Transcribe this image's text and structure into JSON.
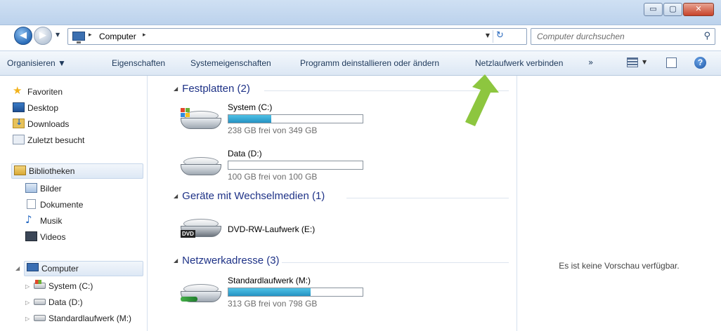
{
  "window": {
    "minimize_glyph": "▭",
    "maximize_glyph": "▢",
    "close_glyph": "✕"
  },
  "address": {
    "path_separator": "▸",
    "location": "Computer",
    "dropdown_glyph": "▼",
    "refresh_glyph": "↻"
  },
  "search": {
    "placeholder": "Computer durchsuchen",
    "icon_glyph": "⚲"
  },
  "toolbar": {
    "organize": "Organisieren ▼",
    "properties": "Eigenschaften",
    "system_properties": "Systemeigenschaften",
    "uninstall": "Programm deinstallieren oder ändern",
    "map_network_drive": "Netzlaufwerk verbinden",
    "more": "»",
    "views_drop": "▼",
    "help": "?"
  },
  "nav": {
    "favorites": "Favoriten",
    "desktop": "Desktop",
    "downloads": "Downloads",
    "recent": "Zuletzt besucht",
    "libraries": "Bibliotheken",
    "pictures": "Bilder",
    "documents": "Dokumente",
    "music": "Musik",
    "videos": "Videos",
    "computer": "Computer",
    "drive_c": "System (C:)",
    "drive_d": "Data (D:)",
    "drive_m": "Standardlaufwerk (M:)",
    "expanded_glyph": "◢",
    "collapsed_glyph": "▷"
  },
  "groups": {
    "hard_disks": "Festplatten (2)",
    "removable": "Geräte mit Wechselmedien (1)",
    "network": "Netzwerkadresse (3)",
    "triangle": "◢"
  },
  "drives": {
    "c": {
      "name": "System (C:)",
      "free": "238 GB frei von 349 GB",
      "used_fraction": 0.32
    },
    "d": {
      "name": "Data (D:)",
      "free": "100 GB frei von 100 GB",
      "used_fraction": 0.0
    },
    "e": {
      "name": "DVD-RW-Laufwerk (E:)",
      "badge": "DVD"
    },
    "m": {
      "name": "Standardlaufwerk (M:)",
      "free": "313 GB frei von 798 GB",
      "used_fraction": 0.61
    }
  },
  "preview": {
    "text": "Es ist keine Vorschau verfügbar."
  },
  "colors": {
    "accent_arrow": "#8dc63f",
    "group_header": "#1e3287",
    "bar_fill": "#2592c2"
  }
}
